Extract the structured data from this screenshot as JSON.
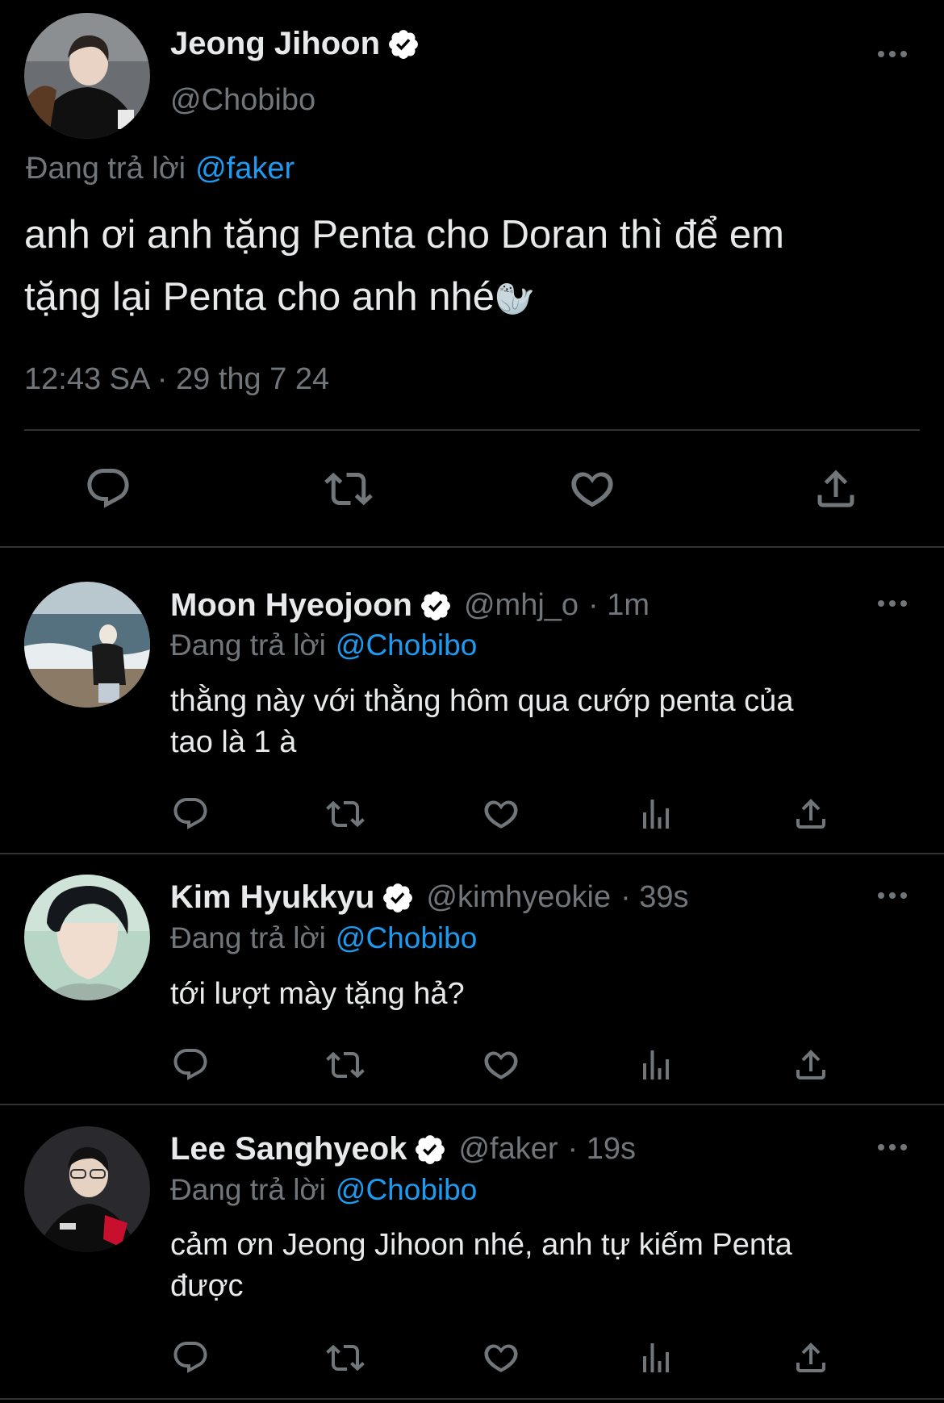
{
  "main_tweet": {
    "author": "Jeong Jihoon",
    "handle": "@Chobibo",
    "replying_prefix": "Đang trả lời",
    "replying_to": "@faker",
    "text_line1": "anh ơi anh tặng Penta cho Doran thì để em",
    "text_line2": "tặng lại Penta cho anh nhé",
    "emoji": "🦭",
    "timestamp": "12:43 SA · 29 thg 7 24",
    "actions": [
      "reply-icon",
      "retweet-icon",
      "like-icon",
      "share-icon"
    ]
  },
  "replies": [
    {
      "author": "Moon Hyeojoon",
      "handle": "@mhj_o",
      "time": "· 1m",
      "replying_prefix": "Đang trả lời",
      "replying_to": "@Chobibo",
      "text_line1": "thằng này với thằng hôm qua cướp penta của",
      "text_line2": "tao là 1 à"
    },
    {
      "author": "Kim Hyukkyu",
      "handle": "@kimhyeokie",
      "time": "· 39s",
      "replying_prefix": "Đang trả lời",
      "replying_to": "@Chobibo",
      "text_line1": "tới lượt mày tặng hả?",
      "text_line2": ""
    },
    {
      "author": "Lee Sanghyeok",
      "handle": "@faker",
      "time": "· 19s",
      "replying_prefix": "Đang trả lời",
      "replying_to": "@Chobibo",
      "text_line1": "cảm ơn Jeong Jihoon nhé, anh tự kiếm Penta",
      "text_line2": "được"
    }
  ],
  "colors": {
    "background": "#000000",
    "text": "#e7e9ea",
    "secondary": "#71767b",
    "link": "#1d9bf0",
    "divider": "#2f3336"
  },
  "reply_actions": [
    "reply-icon",
    "retweet-icon",
    "like-icon",
    "views-icon",
    "share-icon"
  ]
}
